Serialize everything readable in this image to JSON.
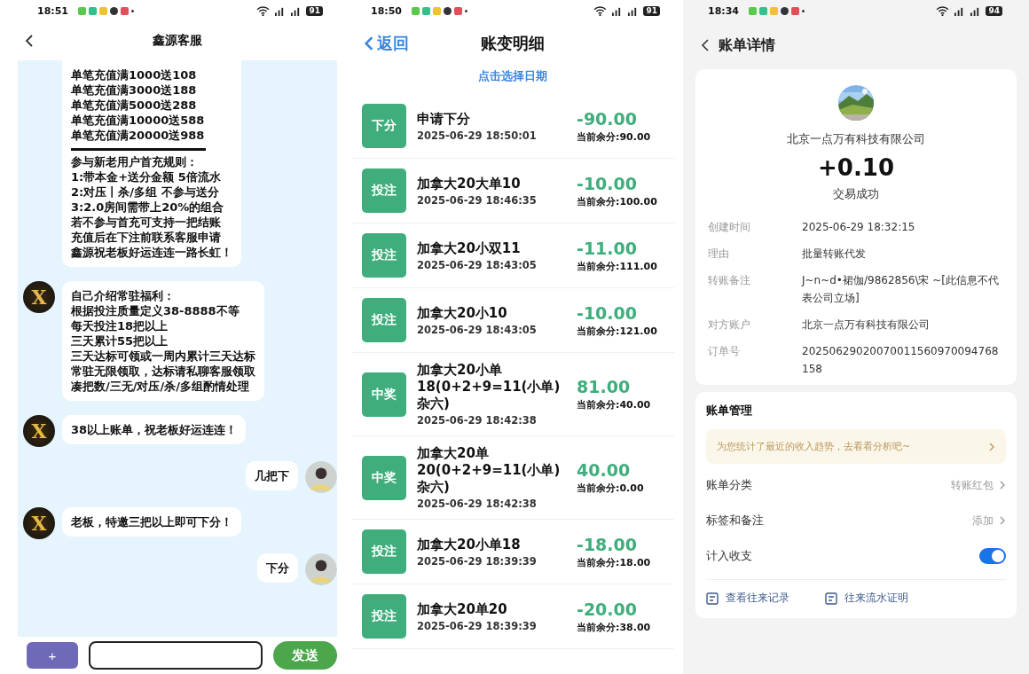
{
  "chat": {
    "status_bar": {
      "time": "18:51",
      "battery": "91"
    },
    "title": "鑫源客服",
    "messages": [
      {
        "kind": "incoming",
        "blocks": [
          [
            "单笔充值满1000送108",
            "单笔充值满3000送188",
            "单笔充值满5000送288",
            "单笔充值满10000送588",
            "单笔充值满20000送988"
          ],
          [
            "参与新老用户首充规则：",
            "1:带本金+送分金额 5倍流水",
            "2:对压丨杀/多组 不参与送分",
            "3:2.0房间需带上20%的组合",
            "若不参与首充可支持一把结账",
            "充值后在下注前联系客服申请",
            "鑫源祝老板好运连连一路长虹！"
          ]
        ]
      },
      {
        "kind": "incoming",
        "avatar_text": "X",
        "blocks": [
          [
            "自己介绍常驻福利：",
            "根据投注质量定义38-8888不等",
            "每天投注18把以上",
            "三天累计55把以上",
            "三天达标可领或一周内累计三天达标",
            "常驻无限领取，达标请私聊客服领取",
            "凑把数/三无/对压/杀/多组酌情处理"
          ]
        ]
      },
      {
        "kind": "incoming",
        "avatar_text": "X",
        "blocks": [
          [
            "38以上账单，祝老板好运连连！"
          ]
        ]
      },
      {
        "kind": "outgoing",
        "blocks": [
          [
            "几把下"
          ]
        ]
      },
      {
        "kind": "incoming",
        "avatar_text": "X",
        "blocks": [
          [
            "老板，特邀三把以上即可下分！"
          ]
        ]
      },
      {
        "kind": "outgoing",
        "blocks": [
          [
            "下分"
          ]
        ]
      }
    ],
    "plus": "+",
    "send": "发送"
  },
  "ledger": {
    "status_bar": {
      "time": "18:50",
      "battery": "91"
    },
    "back": "返回",
    "title": "账变明细",
    "date_picker": "点击选择日期",
    "entries": [
      {
        "tag": "下分",
        "title": "申请下分",
        "time": "2025-06-29 18:50:01",
        "amount": "-90.00",
        "balance": "当前余分:90.00"
      },
      {
        "tag": "投注",
        "title": "加拿大20大单10",
        "time": "2025-06-29 18:46:35",
        "amount": "-10.00",
        "balance": "当前余分:100.00"
      },
      {
        "tag": "投注",
        "title": "加拿大20小双11",
        "time": "2025-06-29 18:43:05",
        "amount": "-11.00",
        "balance": "当前余分:111.00"
      },
      {
        "tag": "投注",
        "title": "加拿大20小10",
        "time": "2025-06-29 18:43:05",
        "amount": "-10.00",
        "balance": "当前余分:121.00"
      },
      {
        "tag": "中奖",
        "title": "加拿大20小单18(0+2+9=11(小单)杂六)",
        "time": "2025-06-29 18:42:38",
        "amount": "81.00",
        "balance": "当前余分:40.00"
      },
      {
        "tag": "中奖",
        "title": "加拿大20单20(0+2+9=11(小单)杂六)",
        "time": "2025-06-29 18:42:38",
        "amount": "40.00",
        "balance": "当前余分:0.00"
      },
      {
        "tag": "投注",
        "title": "加拿大20小单18",
        "time": "2025-06-29 18:39:39",
        "amount": "-18.00",
        "balance": "当前余分:18.00"
      },
      {
        "tag": "投注",
        "title": "加拿大20单20",
        "time": "2025-06-29 18:39:39",
        "amount": "-20.00",
        "balance": "当前余分:38.00"
      }
    ]
  },
  "bill": {
    "status_bar": {
      "time": "18:34",
      "battery": "94"
    },
    "title": "账单详情",
    "merchant": "北京一点万有科技有限公司",
    "amount": "+0.10",
    "status": "交易成功",
    "fields": [
      {
        "label": "创建时间",
        "value": "2025-06-29 18:32:15"
      },
      {
        "label": "理由",
        "value": "批量转账代发"
      },
      {
        "label": "转账备注",
        "value": "J~n~d•裙伽/9862856\\宋 ~[此信息不代表公司立场]"
      },
      {
        "label": "对方账户",
        "value": "北京一点万有科技有限公司"
      },
      {
        "label": "订单号",
        "value": "20250629020070011560970094768158"
      }
    ],
    "management": {
      "title": "账单管理",
      "tip": "为您统计了最近的收入趋势，去看看分析吧~",
      "rows": [
        {
          "kind": "link",
          "label": "账单分类",
          "value": "转账红包"
        },
        {
          "kind": "link",
          "label": "标签和备注",
          "value": "添加"
        },
        {
          "kind": "switch",
          "label": "计入收支",
          "on": true
        }
      ],
      "actions": [
        "查看往来记录",
        "往来流水证明"
      ]
    }
  }
}
